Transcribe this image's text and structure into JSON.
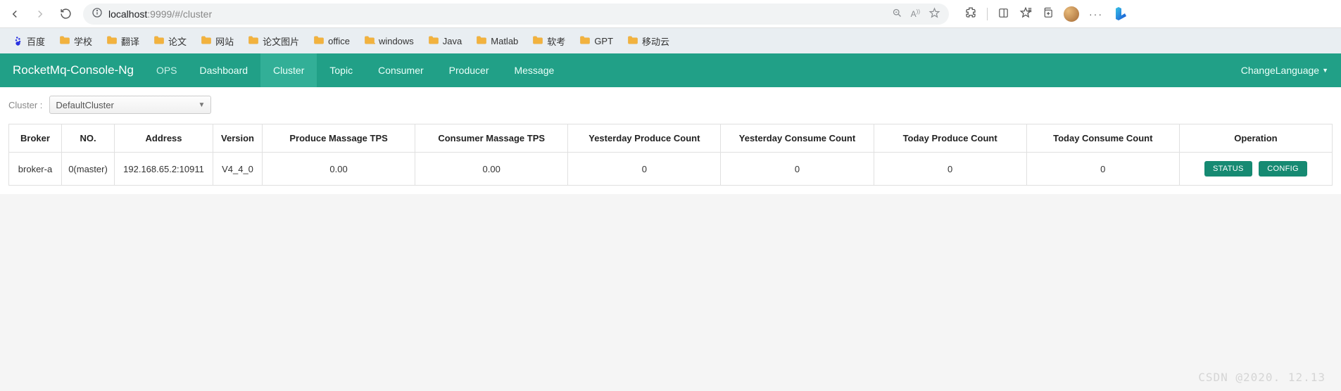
{
  "browser": {
    "url_host": "localhost",
    "url_port_path": ":9999/#/cluster"
  },
  "bookmarks": [
    {
      "label": "百度",
      "icon": "baidu"
    },
    {
      "label": "学校",
      "icon": "folder"
    },
    {
      "label": "翻译",
      "icon": "folder"
    },
    {
      "label": "论文",
      "icon": "folder"
    },
    {
      "label": "网站",
      "icon": "folder"
    },
    {
      "label": "论文图片",
      "icon": "folder"
    },
    {
      "label": "office",
      "icon": "folder"
    },
    {
      "label": "windows",
      "icon": "folder"
    },
    {
      "label": "Java",
      "icon": "folder"
    },
    {
      "label": "Matlab",
      "icon": "folder"
    },
    {
      "label": "软考",
      "icon": "folder"
    },
    {
      "label": "GPT",
      "icon": "folder"
    },
    {
      "label": "移动云",
      "icon": "folder"
    }
  ],
  "app": {
    "brand": "RocketMq-Console-Ng",
    "ops": "OPS",
    "nav": {
      "dashboard": "Dashboard",
      "cluster": "Cluster",
      "topic": "Topic",
      "consumer": "Consumer",
      "producer": "Producer",
      "message": "Message"
    },
    "lang": "ChangeLanguage"
  },
  "cluster": {
    "label": "Cluster :",
    "selected": "DefaultCluster"
  },
  "table": {
    "headers": {
      "broker": "Broker",
      "no": "NO.",
      "address": "Address",
      "version": "Version",
      "produceTps": "Produce Massage TPS",
      "consumerTps": "Consumer Massage TPS",
      "yesterdayProduce": "Yesterday Produce Count",
      "yesterdayConsume": "Yesterday Consume Count",
      "todayProduce": "Today Produce Count",
      "todayConsume": "Today Consume Count",
      "operation": "Operation"
    },
    "rows": [
      {
        "broker": "broker-a",
        "no": "0(master)",
        "address": "192.168.65.2:10911",
        "version": "V4_4_0",
        "produceTps": "0.00",
        "consumerTps": "0.00",
        "yesterdayProduce": "0",
        "yesterdayConsume": "0",
        "todayProduce": "0",
        "todayConsume": "0"
      }
    ],
    "buttons": {
      "status": "STATUS",
      "config": "CONFIG"
    }
  },
  "watermark": "CSDN @2020. 12.13"
}
